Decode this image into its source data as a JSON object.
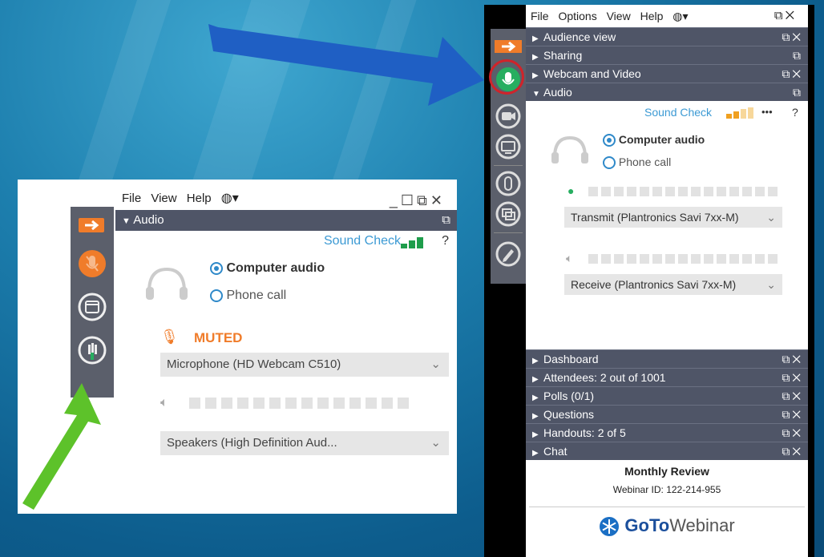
{
  "left_window": {
    "menu": [
      "File",
      "View",
      "Help"
    ],
    "section_title": "Audio",
    "sound_check": "Sound Check",
    "help": "?",
    "audio_options": [
      {
        "label": "Computer audio",
        "selected": true
      },
      {
        "label": "Phone call",
        "selected": false
      }
    ],
    "muted_label": "MUTED",
    "microphone_select": "Microphone (HD Webcam C510)",
    "speakers_select": "Speakers (High Definition Aud..."
  },
  "right_window": {
    "menu": [
      "File",
      "Options",
      "View",
      "Help"
    ],
    "top_sections": [
      {
        "label": "Audience view",
        "expanded": false
      },
      {
        "label": "Sharing",
        "expanded": false
      },
      {
        "label": "Webcam and Video",
        "expanded": false
      },
      {
        "label": "Audio",
        "expanded": true
      }
    ],
    "sound_check": "Sound Check",
    "more": "•••",
    "help": "?",
    "audio_options": [
      {
        "label": "Computer audio",
        "selected": true
      },
      {
        "label": "Phone call",
        "selected": false
      }
    ],
    "transmit_select": "Transmit (Plantronics Savi 7xx-M)",
    "receive_select": "Receive (Plantronics Savi 7xx-M)",
    "bottom_sections": [
      {
        "label": "Dashboard"
      },
      {
        "label": "Attendees:  2 out of 1001"
      },
      {
        "label": "Polls (0/1)"
      },
      {
        "label": "Questions"
      },
      {
        "label": "Handouts: 2 of 5"
      },
      {
        "label": "Chat"
      }
    ],
    "webinar_title": "Monthly Review",
    "webinar_id": "Webinar ID: 122-214-955",
    "brand_goto": "GoTo",
    "brand_webinar": "Webinar"
  },
  "colors": {
    "accent_orange": "#f07c2a",
    "mic_green": "#27ae60",
    "header_slate": "#4f5567",
    "link_blue": "#3c9ad4",
    "arrow_blue": "#1f5fc4",
    "arrow_green": "#5dc22a",
    "highlight_red": "#d0232a"
  },
  "icons": {
    "show_hide": "arrow-right-icon",
    "mic": "microphone-icon",
    "webcam": "webcam-icon",
    "screen": "screen-icon",
    "hand": "raise-hand-icon",
    "drawing": "pen-icon"
  }
}
